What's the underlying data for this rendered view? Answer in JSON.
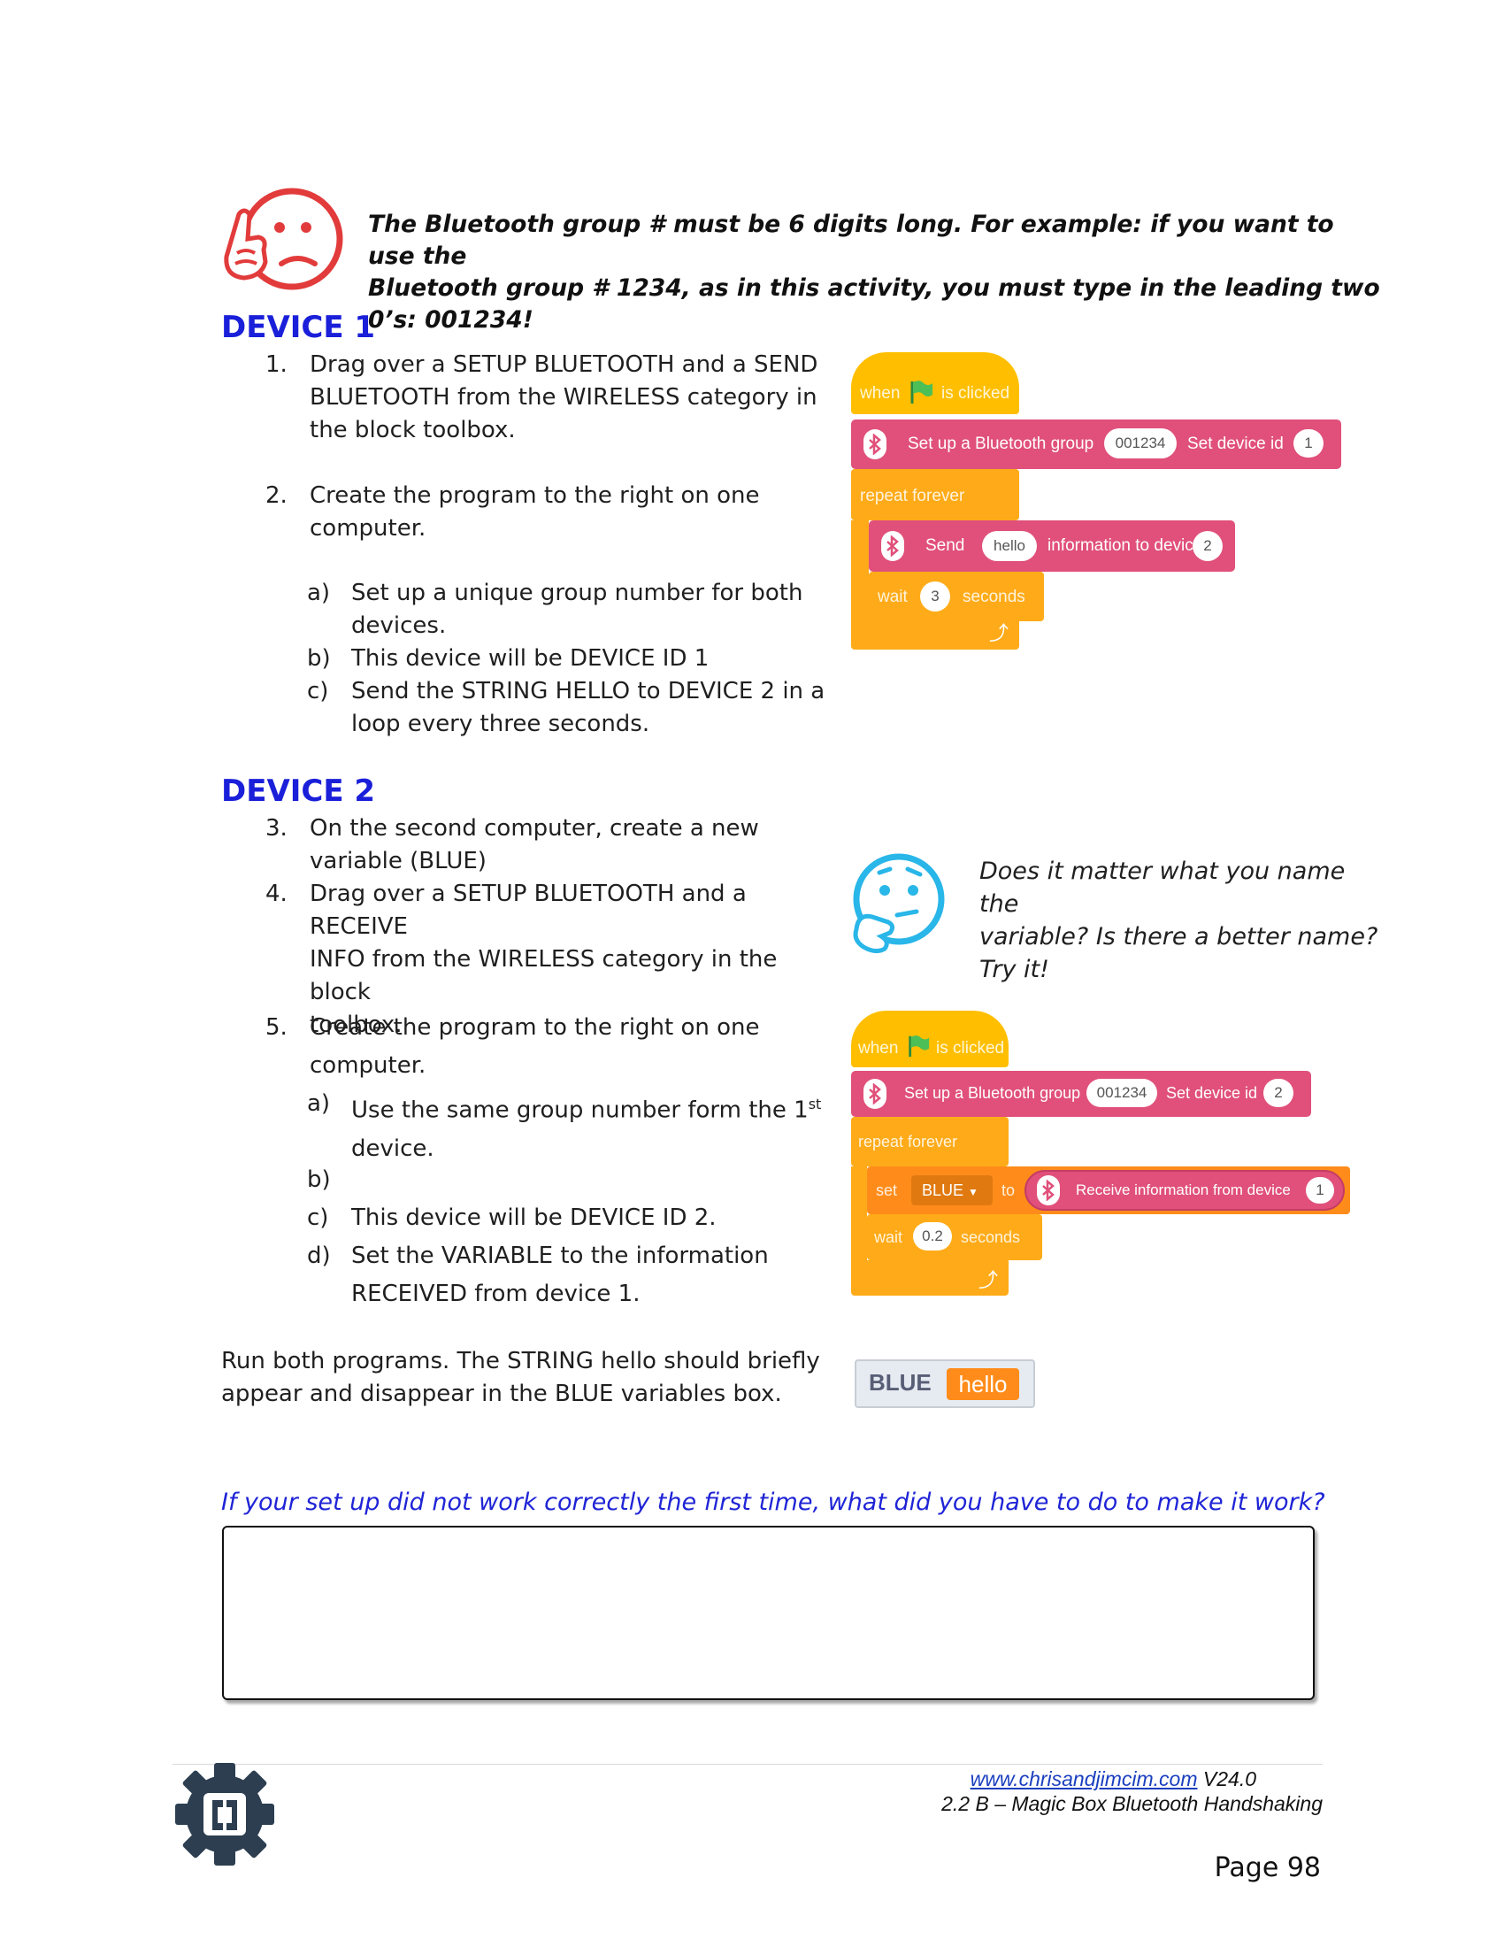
{
  "warning": {
    "text_line1": "The Bluetooth group # must be 6 digits long. For example: if you want to use the",
    "text_line2": "Bluetooth group # 1234, as in this activity, you must type in the leading two 0’s: 001234!"
  },
  "device1": {
    "heading": "DEVICE 1",
    "items": [
      {
        "num": "1.",
        "lines": [
          "Drag over a SETUP BLUETOOTH and a SEND",
          "BLUETOOTH from the WIRELESS category in",
          "the block toolbox."
        ]
      },
      {
        "num": "2.",
        "lines": [
          "Create the program to the right on one",
          "computer."
        ]
      }
    ],
    "subitems": [
      {
        "num": "a)",
        "lines": [
          "Set up a unique group number for both",
          "devices."
        ]
      },
      {
        "num": "b)",
        "lines": [
          "This device will be DEVICE ID 1"
        ]
      },
      {
        "num": "c)",
        "lines": [
          "Send the STRING HELLO to DEVICE 2 in a",
          "loop every three seconds."
        ]
      }
    ],
    "program": {
      "hat_when": "when",
      "hat_clicked": "is clicked",
      "setup_label": "Set up a Bluetooth group",
      "group": "001234",
      "device_label": "Set device id",
      "device_id": "1",
      "repeat": "repeat forever",
      "send": "Send",
      "send_value": "hello",
      "send_to": "information to device",
      "send_device": "2",
      "wait": "wait",
      "wait_value": "3",
      "seconds": "seconds"
    }
  },
  "device2": {
    "heading": "DEVICE 2",
    "items": [
      {
        "num": "3.",
        "lines": [
          "On the second computer, create a new",
          "variable (BLUE)"
        ]
      },
      {
        "num": "4.",
        "lines": [
          "Drag over a SETUP BLUETOOTH and a RECEIVE",
          "INFO from the WIRELESS category in the block",
          "toolbox."
        ]
      },
      {
        "num": "5.",
        "lines": [
          "Create the program to the right on one",
          "computer."
        ]
      }
    ],
    "subitems": {
      "a_num": "a)",
      "a_line1": "Use the same group number form the 1",
      "a_sup": "st",
      "a_line2": "device.",
      "b_num": "b)",
      "c_num": "c)",
      "c_line": "This device will be DEVICE ID 2.",
      "d_num": "d)",
      "d_line1": "Set the VARIABLE to the information",
      "d_line2": "RECEIVED from device 1."
    },
    "think_lines": [
      "Does it matter what you name the",
      "variable? Is there a better name?",
      "Try it!"
    ],
    "program": {
      "hat_when": "when",
      "hat_clicked": "is clicked",
      "setup_label": "Set up a Bluetooth group",
      "group": "001234",
      "device_label": "Set device id",
      "device_id": "2",
      "repeat": "repeat forever",
      "set": "set",
      "variable": "BLUE",
      "to": "to",
      "receive_label": "Receive information from device",
      "receive_device": "1",
      "wait": "wait",
      "wait_value": "0.2",
      "seconds": "seconds"
    }
  },
  "run_text": [
    "Run both programs. The STRING hello should briefly",
    "appear and disappear in the BLUE variables box."
  ],
  "monitor": {
    "label": "BLUE",
    "value": "hello"
  },
  "question": "If your set up did not work correctly the first time, what did you have to do to make it work?",
  "footer": {
    "url": "www.chrisandjimcim.com",
    "version": "V24.0",
    "title": "2.2 B – Magic Box Bluetooth Handshaking",
    "page": "Page 98"
  },
  "colors": {
    "heading": "#1a1fd9",
    "question": "#1f24d6",
    "event": "#ffbf00",
    "control": "#ffab19",
    "bluetooth": "#e0507a",
    "variable": "#ff8c1a"
  }
}
